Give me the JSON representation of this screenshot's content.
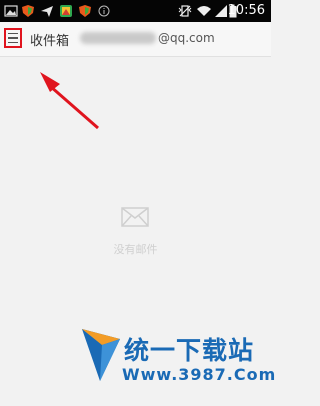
{
  "status_bar": {
    "time": "10:56",
    "icons": [
      "image-icon",
      "shield-icon",
      "send-icon",
      "photo-app-icon",
      "shield-icon",
      "info-icon",
      "vibrate-icon",
      "wifi-icon",
      "signal-icon",
      "battery-icon"
    ]
  },
  "app_bar": {
    "menu_icon": "hamburger-menu-icon",
    "title": "收件箱",
    "account_domain": "@qq.com"
  },
  "empty_state": {
    "icon": "envelope-icon",
    "message": "没有邮件"
  },
  "watermark": {
    "site_name": "统一下载站",
    "url": "Www.3987.Com"
  },
  "colors": {
    "highlight": "#e0141e",
    "background": "#f2f2f2",
    "watermark": "#1a6ab5"
  }
}
